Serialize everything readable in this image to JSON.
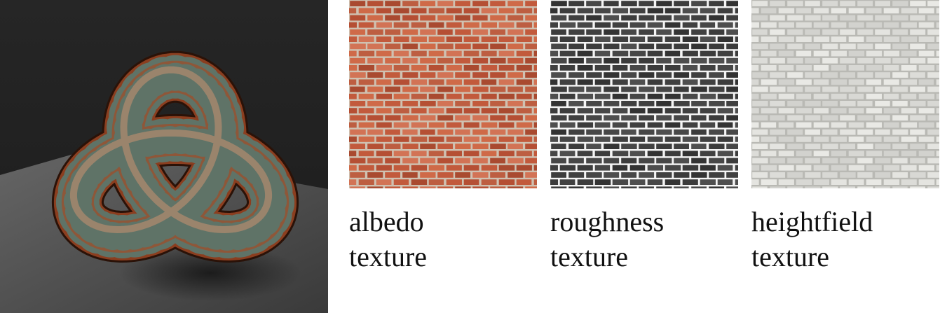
{
  "textures": [
    {
      "name": "albedo",
      "word": "albedo",
      "suffix": "texture",
      "mortar": "#cfc1b1",
      "brick_colors": [
        "#c25a3c",
        "#b54f34",
        "#cf6a48",
        "#a94a30",
        "#d27355",
        "#bd5e41"
      ]
    },
    {
      "name": "roughness",
      "word": "roughness",
      "suffix": "texture",
      "mortar": "#f4f4f4",
      "brick_colors": [
        "#3c3c3c",
        "#474747",
        "#333333",
        "#4e4e4e",
        "#404040"
      ]
    },
    {
      "name": "heightfield",
      "word": "heightfield",
      "suffix": "texture",
      "mortar": "#b9b9b4",
      "brick_colors": [
        "#dcdcd8",
        "#e4e4e0",
        "#d2d2ce",
        "#e9e9e5",
        "#d8d8d4"
      ]
    }
  ],
  "render": {
    "background_top": "#262626",
    "background_bottom": "#1c1c1c",
    "floor": "#5a5a5a",
    "copper": "#8b3e1f",
    "copper_highlight": "#e29a74",
    "mortar": "#5f7367"
  }
}
